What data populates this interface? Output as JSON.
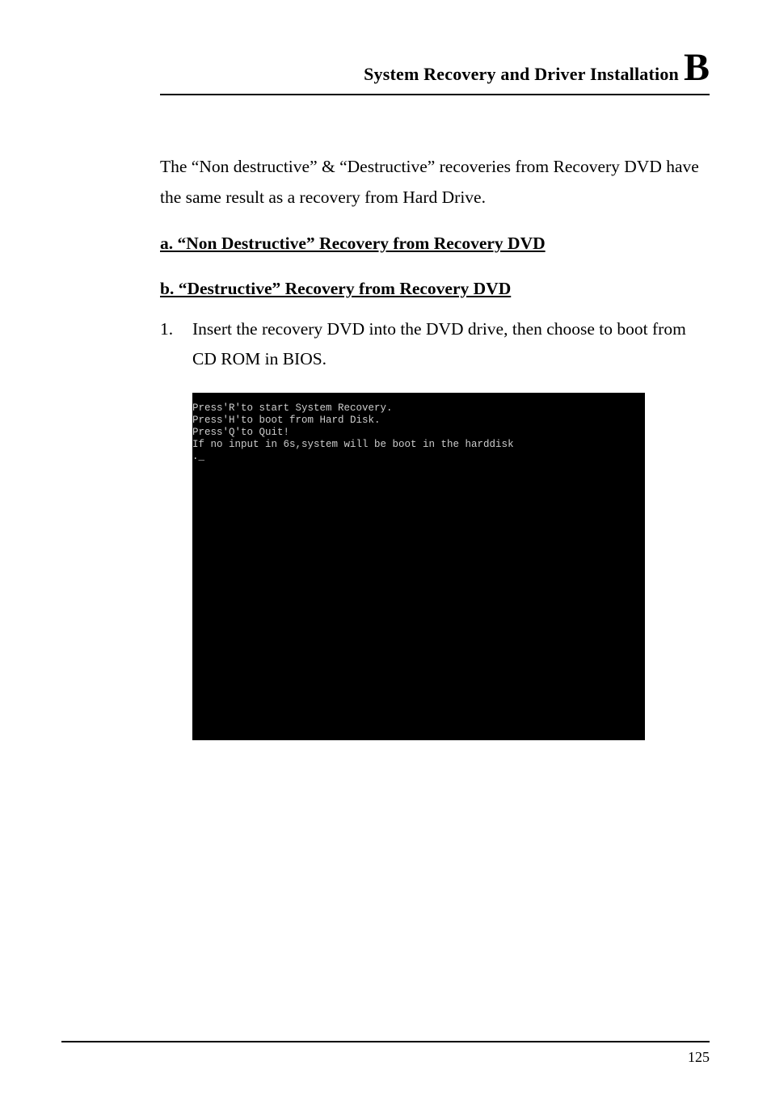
{
  "header": {
    "title": "System Recovery and Driver Installation",
    "letter": "B"
  },
  "content": {
    "intro": "The “Non destructive” & “Destructive” recoveries from Recovery DVD have the same result as a recovery from Hard Drive.",
    "sub_a": "a.  “Non Destructive” Recovery from Recovery DVD",
    "sub_b": "b.  “Destructive” Recovery from Recovery DVD",
    "step1_num": "1.",
    "step1_text": "Insert the recovery DVD into the DVD drive, then choose to boot from CD ROM in BIOS."
  },
  "terminal": {
    "line1": "Press'R'to start System Recovery.",
    "line2": "Press'H'to boot from Hard Disk.",
    "line3": "Press'Q'to Quit!",
    "line4": "If no input in 6s,system will be boot in the harddisk",
    "line5": "._"
  },
  "footer": {
    "page_number": "125"
  }
}
